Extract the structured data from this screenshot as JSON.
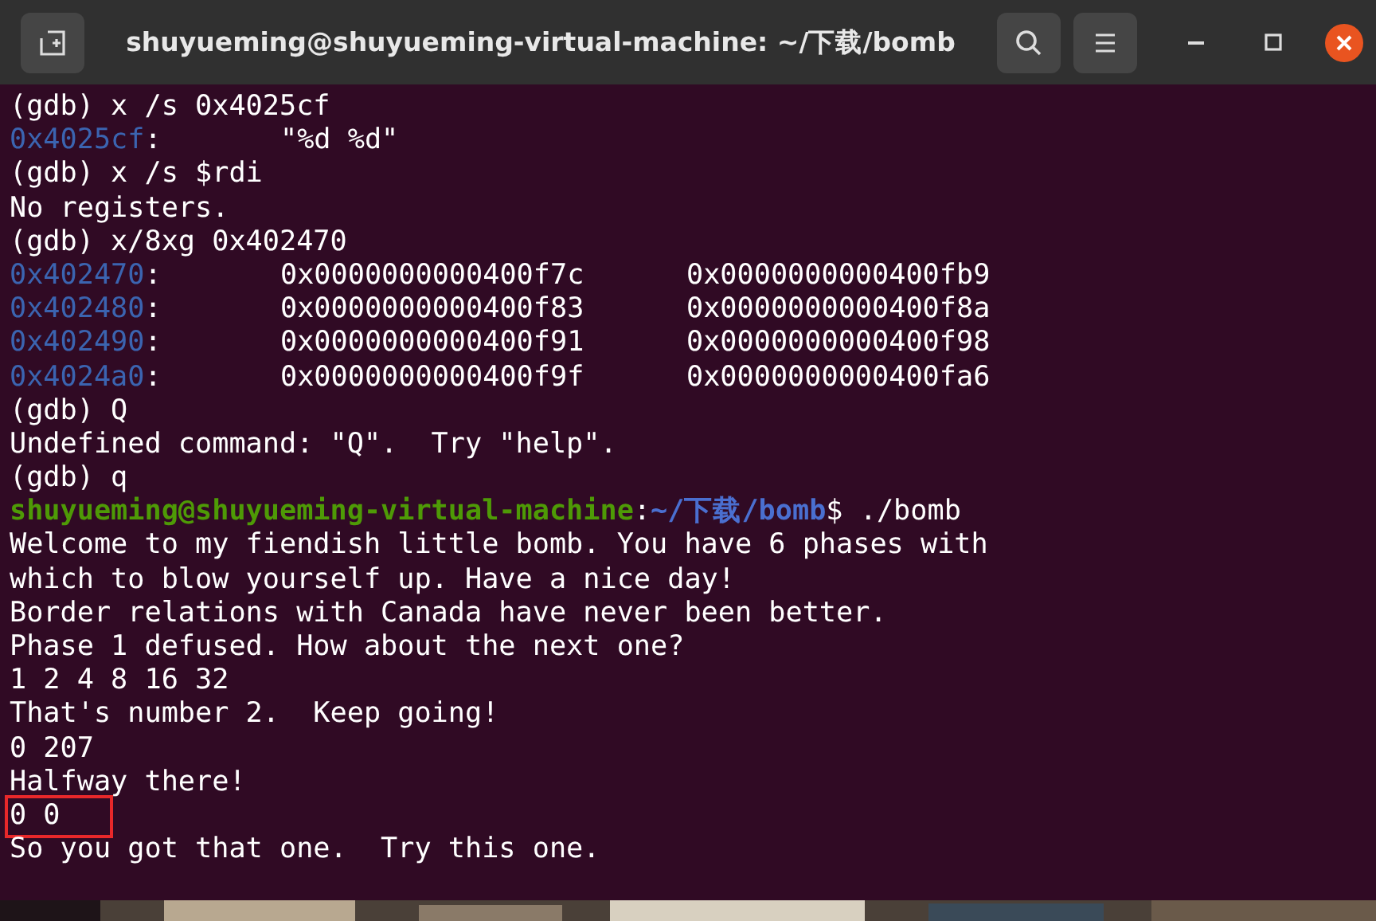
{
  "window": {
    "title": "shuyueming@shuyueming-virtual-machine: ~/下载/bomb"
  },
  "terminal": {
    "lines": [
      {
        "kind": "text",
        "text": "(gdb) x /s 0x4025cf"
      },
      {
        "kind": "memory",
        "address": "0x4025cf",
        "sep": ":",
        "values": [
          "\"%d %d\""
        ]
      },
      {
        "kind": "text",
        "text": "(gdb) x /s $rdi"
      },
      {
        "kind": "text",
        "text": "No registers."
      },
      {
        "kind": "text",
        "text": "(gdb) x/8xg 0x402470"
      },
      {
        "kind": "memory",
        "address": "0x402470",
        "sep": ":",
        "values": [
          "0x0000000000400f7c",
          "0x0000000000400fb9"
        ]
      },
      {
        "kind": "memory",
        "address": "0x402480",
        "sep": ":",
        "values": [
          "0x0000000000400f83",
          "0x0000000000400f8a"
        ]
      },
      {
        "kind": "memory",
        "address": "0x402490",
        "sep": ":",
        "values": [
          "0x0000000000400f91",
          "0x0000000000400f98"
        ]
      },
      {
        "kind": "memory",
        "address": "0x4024a0",
        "sep": ":",
        "values": [
          "0x0000000000400f9f",
          "0x0000000000400fa6"
        ]
      },
      {
        "kind": "text",
        "text": "(gdb) Q"
      },
      {
        "kind": "text",
        "text": "Undefined command: \"Q\".  Try \"help\"."
      },
      {
        "kind": "text",
        "text": "(gdb) q"
      },
      {
        "kind": "prompt",
        "user": "shuyueming@shuyueming-virtual-machine",
        "sep": ":",
        "path": "~/下载/bomb",
        "command": "$ ./bomb"
      },
      {
        "kind": "text",
        "text": "Welcome to my fiendish little bomb. You have 6 phases with"
      },
      {
        "kind": "text",
        "text": "which to blow yourself up. Have a nice day!"
      },
      {
        "kind": "text",
        "text": "Border relations with Canada have never been better."
      },
      {
        "kind": "text",
        "text": "Phase 1 defused. How about the next one?"
      },
      {
        "kind": "text",
        "text": "1 2 4 8 16 32"
      },
      {
        "kind": "text",
        "text": "That's number 2.  Keep going!"
      },
      {
        "kind": "text",
        "text": "0 207"
      },
      {
        "kind": "text",
        "text": "Halfway there!"
      },
      {
        "kind": "text",
        "text": "0 0",
        "highlighted": true
      },
      {
        "kind": "text",
        "text": "So you got that one.  Try this one."
      }
    ]
  }
}
